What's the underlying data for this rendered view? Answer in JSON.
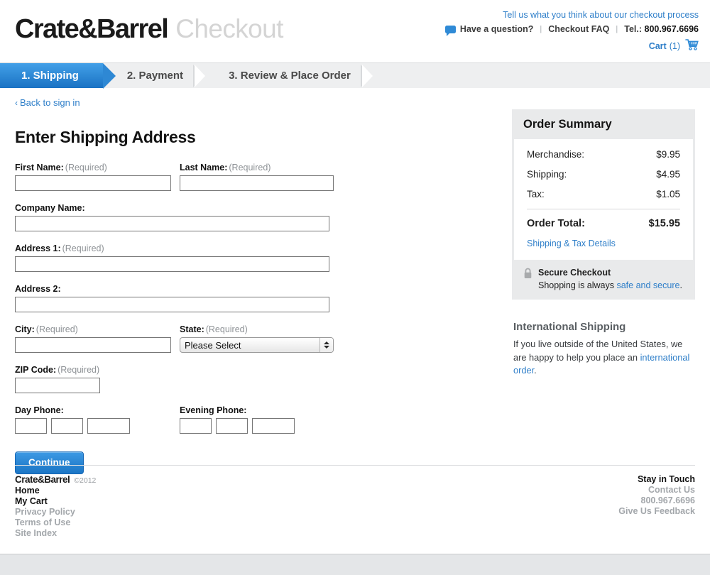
{
  "header": {
    "logo_brand": "Crate&Barrel",
    "logo_section": "Checkout",
    "feedback_link": "Tell us what you think about our checkout process",
    "bubble_icon": "speech-bubble-icon",
    "have_question": "Have a question?",
    "separator": "|",
    "checkout_faq": "Checkout FAQ",
    "tel_label": "Tel.:",
    "tel_number": "800.967.6696",
    "cart_label": "Cart",
    "cart_count": "(1)",
    "cart_icon": "shopping-cart-icon"
  },
  "steps": [
    {
      "label": "1. Shipping",
      "active": true
    },
    {
      "label": "2. Payment",
      "active": false
    },
    {
      "label": "3. Review & Place Order",
      "active": false
    }
  ],
  "back_link": {
    "chevron": "‹",
    "label": "Back to sign in"
  },
  "form": {
    "title": "Enter Shipping Address",
    "required_note": "(Required)",
    "labels": {
      "first_name": "First Name:",
      "last_name": "Last Name:",
      "company_name": "Company Name:",
      "address1": "Address 1:",
      "address2": "Address 2:",
      "city": "City:",
      "state": "State:",
      "zip": "ZIP Code:",
      "day_phone": "Day Phone:",
      "evening_phone": "Evening Phone:"
    },
    "values": {
      "first_name": "",
      "last_name": "",
      "company_name": "",
      "address1": "",
      "address2": "",
      "city": "",
      "zip": "",
      "day_phone_1": "",
      "day_phone_2": "",
      "day_phone_3": "",
      "eve_phone_1": "",
      "eve_phone_2": "",
      "eve_phone_3": ""
    },
    "state_selected": "Please Select",
    "state_options": [
      "Please Select"
    ],
    "continue_button": "Continue"
  },
  "order_summary": {
    "title": "Order Summary",
    "lines": [
      {
        "label": "Merchandise:",
        "value": "$9.95"
      },
      {
        "label": "Shipping:",
        "value": "$4.95"
      },
      {
        "label": "Tax:",
        "value": "$1.05"
      }
    ],
    "total_label": "Order Total:",
    "total_value": "$15.95",
    "details_link": "Shipping & Tax Details",
    "secure": {
      "icon": "lock-icon",
      "title": "Secure Checkout",
      "text_before": "Shopping is always ",
      "link": "safe and secure",
      "text_after": "."
    }
  },
  "international": {
    "title": "International Shipping",
    "text_before": "If you live outside of the United States, we are happy to help you place an ",
    "link": "international order",
    "text_after": "."
  },
  "footer": {
    "brand": "Crate&Barrel",
    "copyright": "©2012",
    "links": [
      {
        "label": "Home",
        "tone": "dark"
      },
      {
        "label": "My Cart",
        "tone": "dark"
      },
      {
        "label": "Privacy Policy",
        "tone": "gray"
      },
      {
        "label": "Terms of Use",
        "tone": "gray"
      },
      {
        "label": "Site Index",
        "tone": "gray"
      }
    ],
    "right_heading": "Stay in Touch",
    "right_links": [
      {
        "label": "Contact Us"
      },
      {
        "label": "800.967.6696"
      },
      {
        "label": "Give Us Feedback"
      }
    ]
  },
  "colors": {
    "accent_blue": "#2f8ad6",
    "link_blue": "#2f7fc9",
    "page_bg": "#e4e6e8",
    "panel_gray": "#e9eaeb"
  }
}
